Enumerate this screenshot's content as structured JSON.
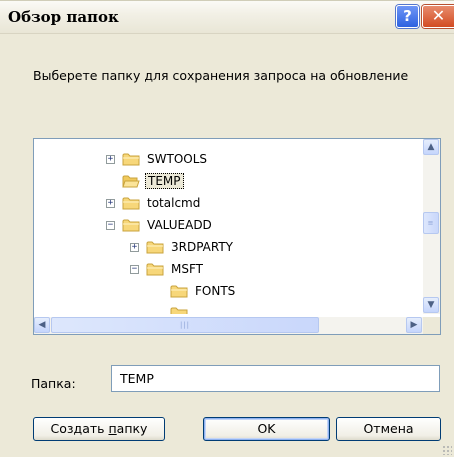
{
  "window": {
    "title": "Обзор папок"
  },
  "titlebar": {
    "help_glyph": "?",
    "close_glyph": "✕"
  },
  "prompt": "Выберете папку для сохранения запроса на обновление",
  "tree": {
    "items": [
      {
        "label": "SWTOOLS",
        "expander": "+",
        "level": 0,
        "selected": false
      },
      {
        "label": "TEMP",
        "expander": "",
        "level": 0,
        "selected": true
      },
      {
        "label": "totalcmd",
        "expander": "+",
        "level": 0,
        "selected": false
      },
      {
        "label": "VALUEADD",
        "expander": "−",
        "level": 0,
        "selected": false
      },
      {
        "label": "3RDPARTY",
        "expander": "+",
        "level": 1,
        "selected": false
      },
      {
        "label": "MSFT",
        "expander": "−",
        "level": 1,
        "selected": false
      },
      {
        "label": "FONTS",
        "expander": "",
        "level": 2,
        "selected": false
      }
    ],
    "scroll_up": "▲",
    "scroll_down": "▼",
    "scroll_left": "◀",
    "scroll_right": "▶"
  },
  "folder": {
    "label": "Папка:",
    "value": "TEMP"
  },
  "buttons": {
    "new_folder_prefix": "Создать ",
    "new_folder_underlined": "п",
    "new_folder_suffix": "апку",
    "ok": "OK",
    "cancel": "Отмена"
  },
  "colors": {
    "folder_yellow": "#f7d77a",
    "border_blue": "#7f9db9",
    "dialog_bg": "#ece9d8"
  }
}
